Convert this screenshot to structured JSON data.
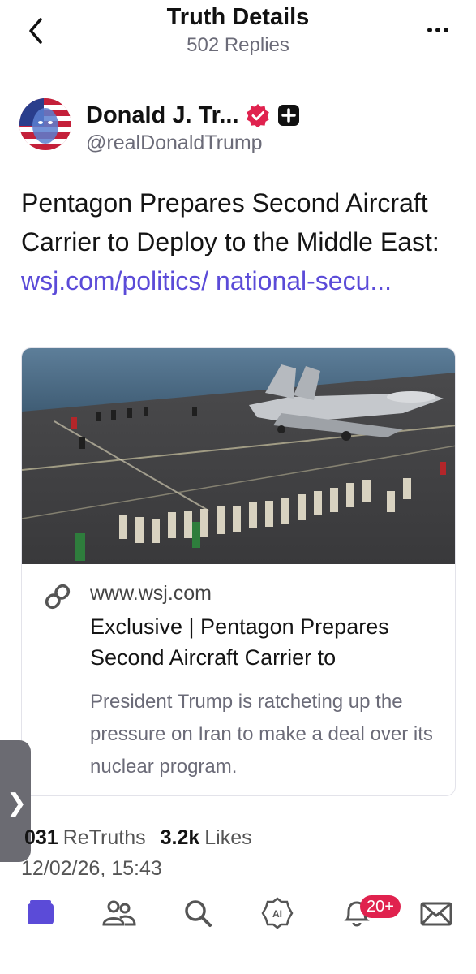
{
  "header": {
    "title": "Truth Details",
    "subtitle": "502 Replies",
    "back_icon": "chevron-left-icon",
    "more_icon": "more-dots-icon"
  },
  "author": {
    "name": "Donald J. Tr...",
    "handle": "@realDonaldTrump",
    "verified_icon": "verified-badge-icon",
    "follow_icon": "plus-icon"
  },
  "post": {
    "text": "Pentagon Prepares Second Aircraft Carrier to Deploy to the Middle East: ",
    "link": "wsj.com/politics/ national-secu..."
  },
  "card": {
    "domain": "www.wsj.com",
    "title": "Exclusive | Pentagon Prepares Second Aircraft Carrier to",
    "description": "President Trump is ratcheting up the pressure on Iran to make a deal over its nuclear program.",
    "link_icon": "link-icon"
  },
  "side_tab": {
    "icon": "chevron-right-icon",
    "glyph": "❯"
  },
  "stats": {
    "retruths_count": "031",
    "retruths_label": "ReTruths",
    "likes_count": "3.2k",
    "likes_label": "Likes",
    "date": "12/02/26, 15:43"
  },
  "tabbar": {
    "items": [
      "home-icon",
      "people-icon",
      "search-icon",
      "ai-icon",
      "bell-icon",
      "mail-icon"
    ],
    "notification_badge": "20+"
  },
  "colors": {
    "accent": "#5b4bd8",
    "badge": "#e0224e",
    "verified": "#e0224e"
  }
}
